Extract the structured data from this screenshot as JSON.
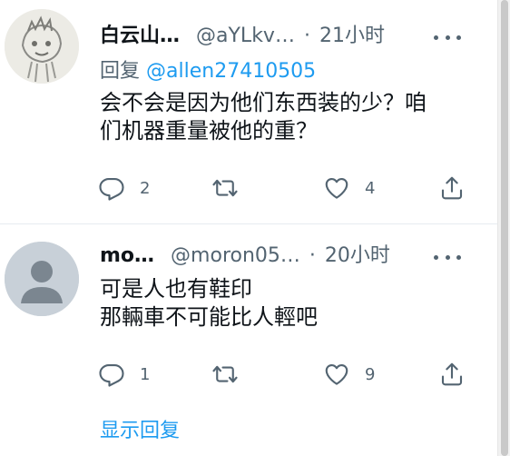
{
  "tweets": [
    {
      "name": "白云山…",
      "handle": "@aYLkv…",
      "separator": "·",
      "time": "21小时",
      "replying_prefix": "回复",
      "replying_to": "@allen27410505",
      "body_lines": [
        "会不会是因为他们东西装的少？咱",
        "们机器重量被他的重？"
      ],
      "reply_count": "2",
      "retweet_count": "",
      "like_count": "4"
    },
    {
      "name": "mo…",
      "handle": "@moron05…",
      "separator": "·",
      "time": "20小时",
      "body_lines": [
        "可是人也有鞋印",
        "那輛車不可能比人輕吧"
      ],
      "reply_count": "1",
      "retweet_count": "",
      "like_count": "9"
    }
  ],
  "show_replies": "显示回复",
  "icons": {
    "reply": "reply-icon",
    "retweet": "retweet-icon",
    "like": "heart-icon",
    "share": "share-icon",
    "more": "more-options-icon"
  },
  "colors": {
    "text": "#0f1419",
    "secondary": "#536471",
    "link": "#1d9bf0",
    "divider": "#e6ecf0"
  }
}
